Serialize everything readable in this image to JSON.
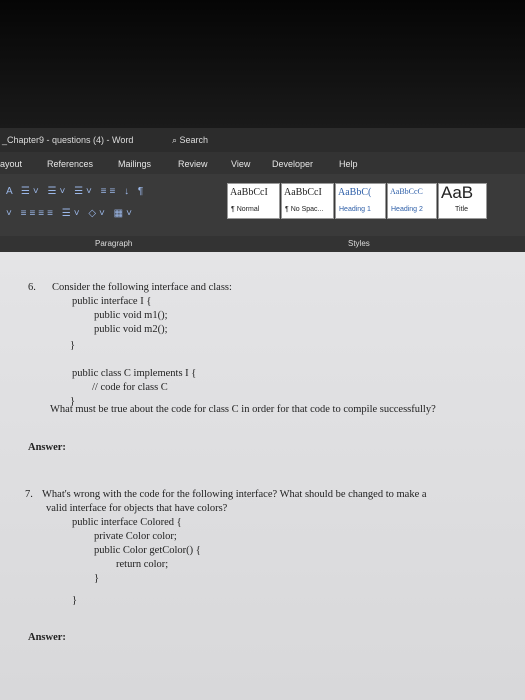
{
  "titlebar": {
    "doc_title": "_Chapter9 - questions (4) - Word",
    "search_label": "Search"
  },
  "tabs": [
    "ayout",
    "References",
    "Mailings",
    "Review",
    "View",
    "Developer",
    "Help"
  ],
  "styles": [
    {
      "sample": "AaBbCcI",
      "label": "¶ Normal"
    },
    {
      "sample": "AaBbCcI",
      "label": "¶ No Spac..."
    },
    {
      "sample": "AaBbC(",
      "label": "Heading 1"
    },
    {
      "sample": "AaBbCcC",
      "label": "Heading 2"
    },
    {
      "sample": "AaB",
      "label": "Title"
    }
  ],
  "groups": {
    "paragraph": "Paragraph",
    "styles": "Styles"
  },
  "document": {
    "q6_number": "6.",
    "q6_lines": [
      "Consider the following interface and class:",
      "public interface I {",
      "public void m1();",
      "public void m2();",
      "}",
      "public class C implements I {",
      "// code for class C",
      "}",
      "What must be true about the code for class C in order for that code to compile successfully?"
    ],
    "answer1": "Answer:",
    "q7_number": "7.",
    "q7_lines": [
      "What's wrong with the code for the following interface? What should be changed to make a",
      "valid interface for objects that have colors?",
      "public interface Colored {",
      "private Color color;",
      "public Color getColor() {",
      "return color;",
      "}",
      "}"
    ],
    "answer2": "Answer:"
  }
}
